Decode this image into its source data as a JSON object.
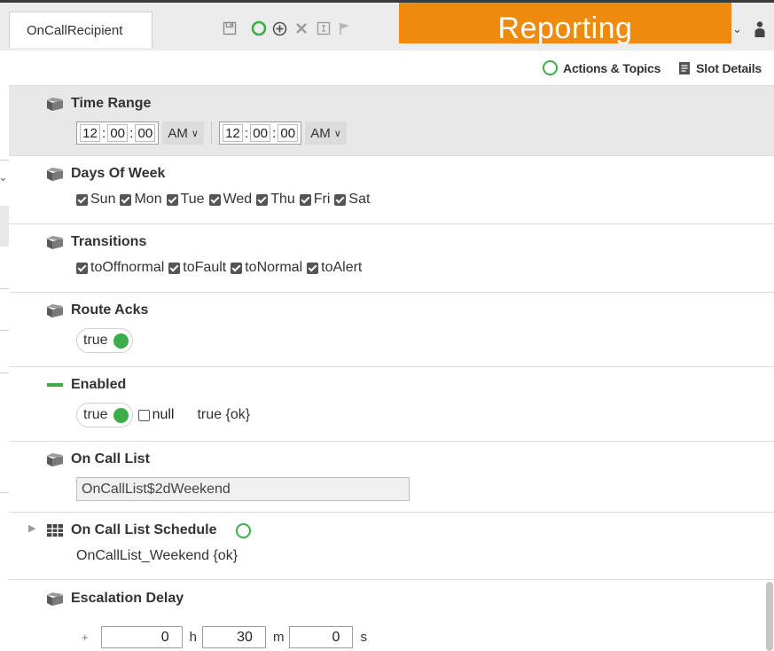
{
  "tab": {
    "title": "OnCallRecipient"
  },
  "banner": {
    "text": "Reporting"
  },
  "actions": {
    "actions_topics": "Actions & Topics",
    "slot_details": "Slot Details"
  },
  "slots": {
    "time_range": {
      "label": "Time Range",
      "start": {
        "h": "12",
        "m": "00",
        "s": "00",
        "ampm": "AM"
      },
      "end": {
        "h": "12",
        "m": "00",
        "s": "00",
        "ampm": "AM"
      }
    },
    "days_of_week": {
      "label": "Days Of Week",
      "days": [
        "Sun",
        "Mon",
        "Tue",
        "Wed",
        "Thu",
        "Fri",
        "Sat"
      ]
    },
    "transitions": {
      "label": "Transitions",
      "items": [
        "toOffnormal",
        "toFault",
        "toNormal",
        "toAlert"
      ]
    },
    "route_acks": {
      "label": "Route Acks",
      "value": "true"
    },
    "enabled": {
      "label": "Enabled",
      "value": "true",
      "null_label": "null",
      "status": "true {ok}"
    },
    "on_call_list": {
      "label": "On Call List",
      "value": "OnCallList$2dWeekend"
    },
    "on_call_list_schedule": {
      "label": "On Call List Schedule",
      "value": "OnCallList_Weekend {ok}"
    },
    "escalation_delay": {
      "label": "Escalation Delay",
      "sign": "+",
      "hours": "0",
      "hours_unit": "h",
      "minutes": "30",
      "minutes_unit": "m",
      "seconds": "0",
      "seconds_unit": "s"
    }
  },
  "colors": {
    "accent_green": "#3cad48",
    "banner_orange": "#ee8a0e"
  }
}
